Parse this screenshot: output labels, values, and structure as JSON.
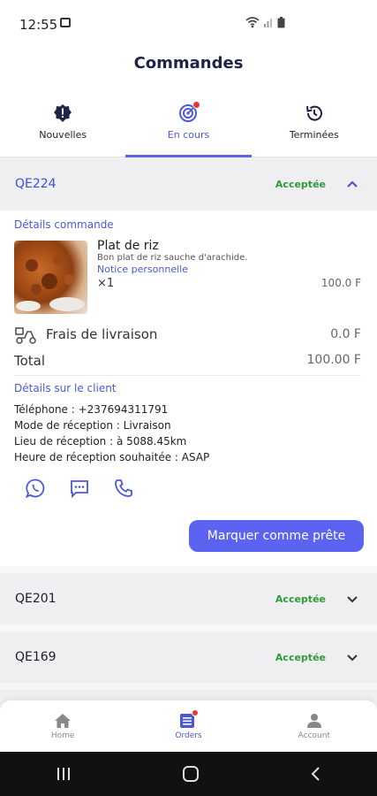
{
  "status_bar": {
    "time": "12:55"
  },
  "header": {
    "title": "Commandes"
  },
  "tabs": [
    {
      "label": "Nouvelles",
      "icon": "alert-circle-icon"
    },
    {
      "label": "En cours",
      "icon": "target-icon"
    },
    {
      "label": "Terminées",
      "icon": "history-icon"
    }
  ],
  "colors": {
    "accent": "#5b63f0",
    "status_green": "#2e9b3a",
    "link_blue": "#4b59d6"
  },
  "orders": [
    {
      "id": "QE224",
      "status": "Acceptée",
      "expanded": true,
      "details_title": "Détails commande",
      "item": {
        "name": "Plat de riz",
        "description": "Bon plat de riz sauche d'arachide.",
        "note": "Notice personnelle",
        "quantity": "×1",
        "price": "100.0 F"
      },
      "delivery_fee_label": "Frais de livraison",
      "delivery_fee": "0.0 F",
      "total_label": "Total",
      "total": "100.00 F",
      "client_title": "Détails sur le client",
      "client_lines": [
        "Téléphone : +237694311791",
        "Mode de réception : Livraison",
        "Lieu de réception : à 5088.45km",
        "Heure de réception souhaitée : ASAP"
      ],
      "action_label": "Marquer comme prête"
    },
    {
      "id": "QE201",
      "status": "Acceptée",
      "expanded": false
    },
    {
      "id": "QE169",
      "status": "Acceptée",
      "expanded": false
    }
  ],
  "bottom_nav": [
    {
      "label": "Home",
      "icon": "home-icon"
    },
    {
      "label": "Orders",
      "icon": "orders-icon"
    },
    {
      "label": "Account",
      "icon": "account-icon"
    }
  ]
}
